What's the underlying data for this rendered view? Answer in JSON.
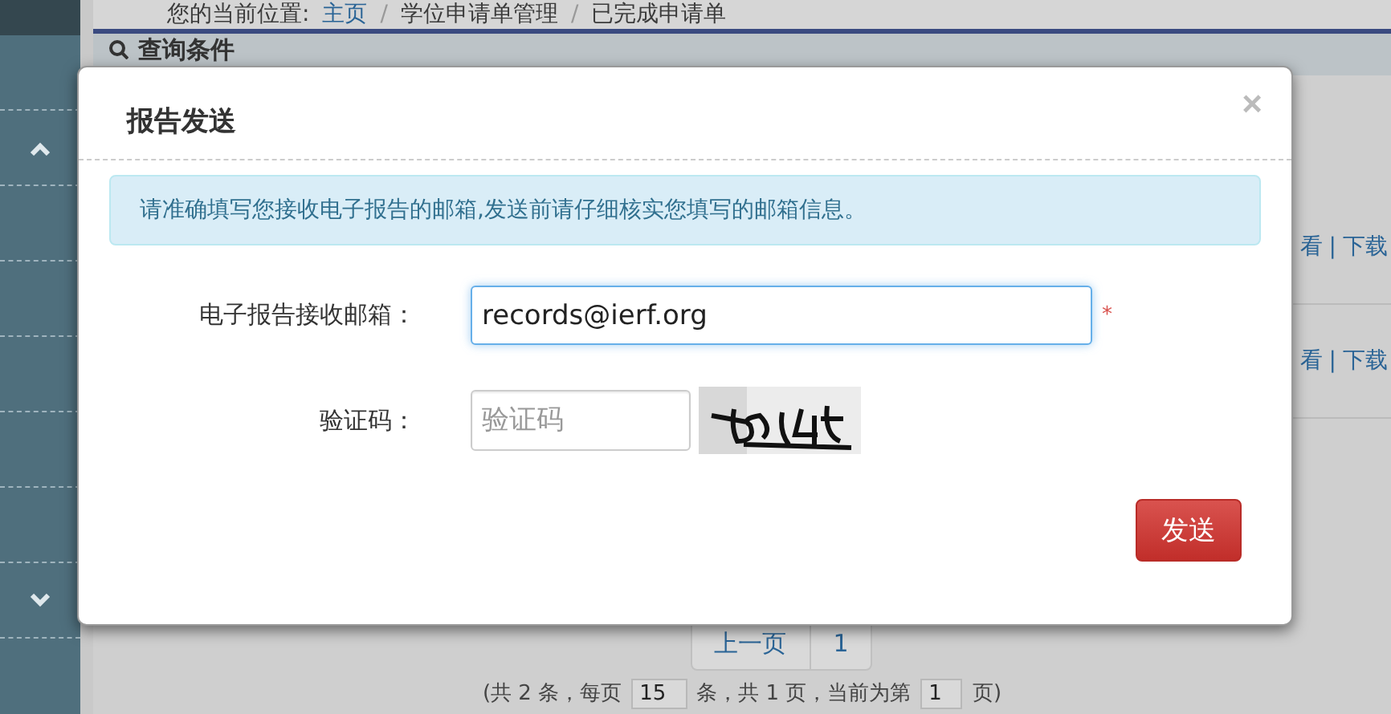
{
  "breadcrumb": {
    "label": "您的当前位置:",
    "separator": "/",
    "items": [
      {
        "text": "主页",
        "link": true
      },
      {
        "text": "学位申请单管理",
        "link": false
      },
      {
        "text": "已完成申请单",
        "link": false
      }
    ]
  },
  "panel": {
    "title": "查询条件"
  },
  "row_actions": [
    {
      "view": "看",
      "separator": "|",
      "download": "下载"
    },
    {
      "view": "看",
      "separator": "|",
      "download": "下载"
    }
  ],
  "pagination": {
    "prev": "上一页",
    "pages": [
      "1"
    ]
  },
  "summary": {
    "before": "(共 2 条，每页",
    "page_size": "15",
    "middle": "条，共 1 页，当前为第",
    "current_page": "1",
    "after": "页)"
  },
  "modal": {
    "title": "报告发送",
    "close": "×",
    "alert": "请准确填写您接收电子报告的邮箱,发送前请仔细核实您填写的邮箱信息。",
    "fields": [
      {
        "kind": "text",
        "label": "电子报告接收邮箱：",
        "value": "records@ierf.org",
        "required_mark": "*",
        "focused": true
      },
      {
        "kind": "captcha",
        "label": "验证码：",
        "placeholder": "验证码",
        "focused": false
      }
    ],
    "submit": "发送"
  }
}
